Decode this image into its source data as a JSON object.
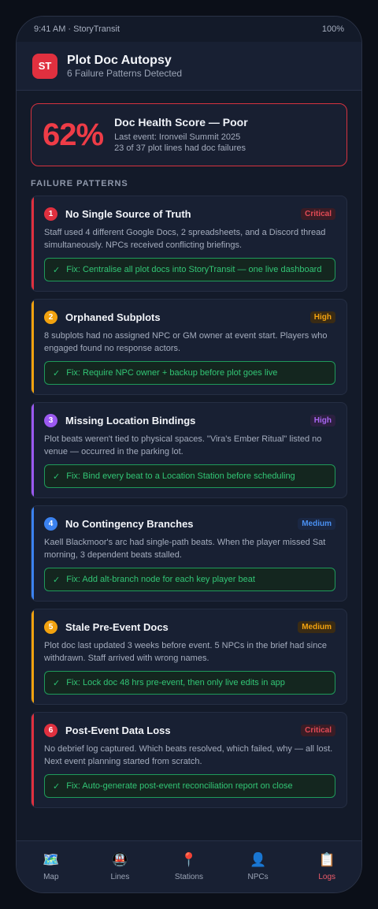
{
  "status_bar": {
    "left": "9:41 AM · StoryTransit",
    "right": "100%"
  },
  "header": {
    "logo": "ST",
    "title": "Plot Doc Autopsy",
    "subtitle": "6 Failure Patterns Detected"
  },
  "health": {
    "score": "62%",
    "title": "Doc Health Score — Poor",
    "line1": "Last event: Ironveil Summit 2025",
    "line2": "23 of 37 plot lines had doc failures",
    "color": "#ee3c47"
  },
  "section_title": "FAILURE PATTERNS",
  "check_icon": "✓",
  "cards": [
    {
      "num": "1",
      "title": "No Single Source of Truth",
      "severity": "Critical",
      "desc": "Staff used 4 different Google Docs, 2 spreadsheets, and a Discord thread simultaneously. NPCs received conflicting briefings.",
      "fix": "Fix: Centralise all plot docs into StoryTransit — one live dashboard",
      "accent": "#e0303f",
      "badge_color": "#e04a55",
      "badge_bg": "#3a1c25"
    },
    {
      "num": "2",
      "title": "Orphaned Subplots",
      "severity": "High",
      "desc": "8 subplots had no assigned NPC or GM owner at event start. Players who engaged found no response actors.",
      "fix": "Fix: Require NPC owner + backup before plot goes live",
      "accent": "#f2a20f",
      "badge_color": "#f2a20f",
      "badge_bg": "#3a2b14"
    },
    {
      "num": "3",
      "title": "Missing Location Bindings",
      "severity": "High",
      "desc": "Plot beats weren't tied to physical spaces. \"Vira's Ember Ritual\" listed no venue — occurred in the parking lot.",
      "fix": "Fix: Bind every beat to a Location Station before scheduling",
      "accent": "#9b59f0",
      "badge_color": "#a866f2",
      "badge_bg": "#2c2040"
    },
    {
      "num": "4",
      "title": "No Contingency Branches",
      "severity": "Medium",
      "desc": "Kaell Blackmoor's arc had single-path beats. When the player missed Sat morning, 3 dependent beats stalled.",
      "fix": "Fix: Add alt-branch node for each key player beat",
      "accent": "#3b82f0",
      "badge_color": "#4a90f2",
      "badge_bg": "#1a2743"
    },
    {
      "num": "5",
      "title": "Stale Pre-Event Docs",
      "severity": "Medium",
      "desc": "Plot doc last updated 3 weeks before event. 5 NPCs in the brief had since withdrawn. Staff arrived with wrong names.",
      "fix": "Fix: Lock doc 48 hrs pre-event, then only live edits in app",
      "accent": "#f2a20f",
      "badge_color": "#f2a20f",
      "badge_bg": "#3a2b14"
    },
    {
      "num": "6",
      "title": "Post-Event Data Loss",
      "severity": "Critical",
      "desc": "No debrief log captured. Which beats resolved, which failed, why — all lost. Next event planning started from scratch.",
      "fix": "Fix: Auto-generate post-event reconciliation report on close",
      "accent": "#e0303f",
      "badge_color": "#e04a55",
      "badge_bg": "#3a1c25"
    }
  ],
  "tabs": [
    {
      "label": "Map",
      "icon": "🗺️",
      "icon_name": "map-icon",
      "active": false
    },
    {
      "label": "Lines",
      "icon": "🚇",
      "icon_name": "train-icon",
      "active": false
    },
    {
      "label": "Stations",
      "icon": "📍",
      "icon_name": "pin-icon",
      "active": false
    },
    {
      "label": "NPCs",
      "icon": "👤",
      "icon_name": "person-icon",
      "active": false
    },
    {
      "label": "Logs",
      "icon": "📋",
      "icon_name": "clipboard-icon",
      "active": true
    }
  ]
}
